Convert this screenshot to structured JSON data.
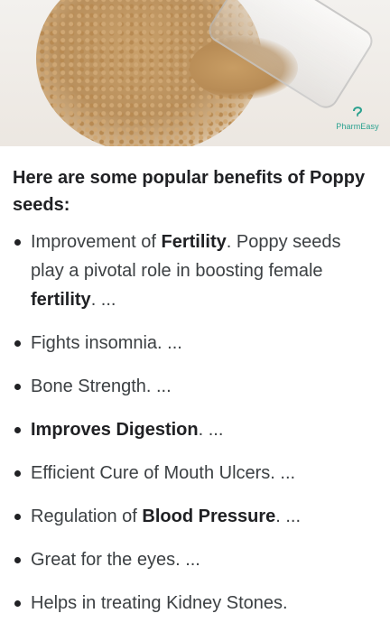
{
  "hero": {
    "image_desc_icon": "poppy-seeds-image",
    "logo_text": "PharmEasy",
    "logo_color": "#2aa18f"
  },
  "heading": "Here are some popular benefits of Poppy seeds:",
  "benefits": [
    {
      "before": "Improvement of ",
      "bold": "Fertility",
      "after": ". Poppy seeds play a pivotal role in boosting female ",
      "bold2": "fertility",
      "after2": ". ..."
    },
    {
      "before": "Fights insomnia. ...",
      "bold": "",
      "after": ""
    },
    {
      "before": "Bone Strength. ...",
      "bold": "",
      "after": ""
    },
    {
      "before": "",
      "bold": "Improves Digestion",
      "after": ". ..."
    },
    {
      "before": "Efficient Cure of Mouth Ulcers. ...",
      "bold": "",
      "after": ""
    },
    {
      "before": "Regulation of ",
      "bold": "Blood Pressure",
      "after": ". ..."
    },
    {
      "before": "Great for the eyes. ...",
      "bold": "",
      "after": ""
    },
    {
      "before": "Helps in treating Kidney Stones.",
      "bold": "",
      "after": ""
    }
  ]
}
